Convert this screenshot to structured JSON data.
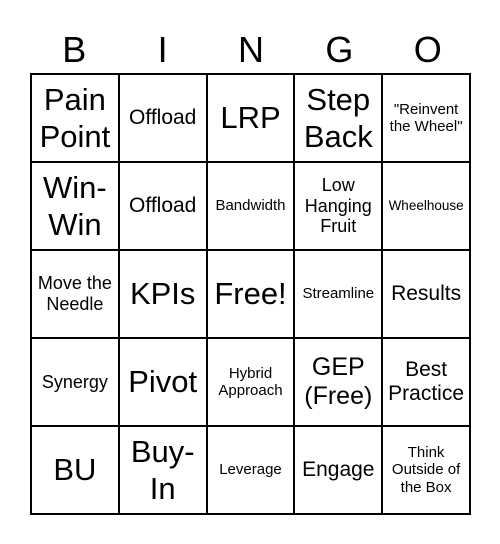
{
  "header": [
    "B",
    "I",
    "N",
    "G",
    "O"
  ],
  "cells": [
    "Pain Point",
    "Offload",
    "LRP",
    "Step Back",
    "\"Reinvent the Wheel\"",
    "Win-Win",
    "Offload",
    "Bandwidth",
    "Low Hanging Fruit",
    "Wheelhouse",
    "Move the Needle",
    "KPIs",
    "Free!",
    "Streamline",
    "Results",
    "Synergy",
    "Pivot",
    "Hybrid Approach",
    "GEP (Free)",
    "Best Practice",
    "BU",
    "Buy-In",
    "Leverage",
    "Engage",
    "Think Outside of the Box"
  ]
}
